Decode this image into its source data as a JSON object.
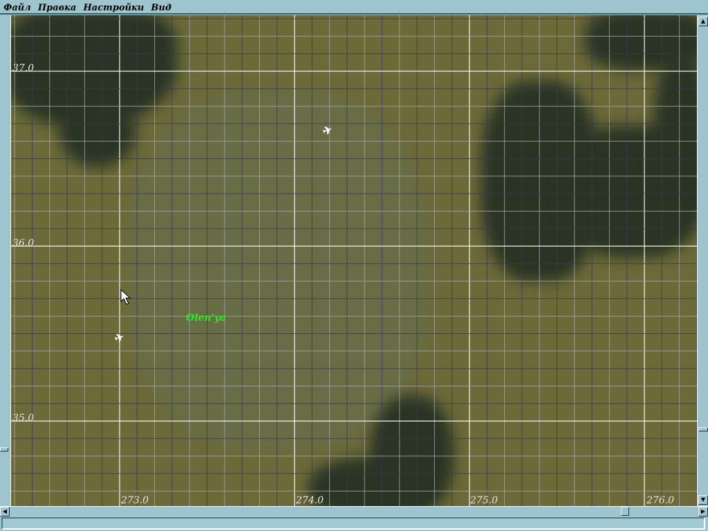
{
  "menu": {
    "items": [
      {
        "label": "Файл"
      },
      {
        "label": "Правка"
      },
      {
        "label": "Настройки"
      },
      {
        "label": "Вид"
      }
    ]
  },
  "map": {
    "lat_labels": [
      "37.0",
      "36.0",
      "35.0"
    ],
    "lon_labels": [
      "273.0",
      "274.0",
      "275.0",
      "276.0"
    ],
    "town_label": "Olen'ya",
    "colors": {
      "town": "#22ee22",
      "major_grid": "#ffffff",
      "minor_grid_light": "#a8a8b0",
      "minor_grid_dark": "#3a3850",
      "terrain": "#6b6a38",
      "forest": "#2a3424"
    },
    "icons": [
      "aircraft-icon",
      "aircraft-icon",
      "cursor-icon"
    ]
  },
  "scrollbars": {
    "vertical_position": 0.85,
    "horizontal_position": 0.88
  },
  "status": {
    "text": ""
  }
}
